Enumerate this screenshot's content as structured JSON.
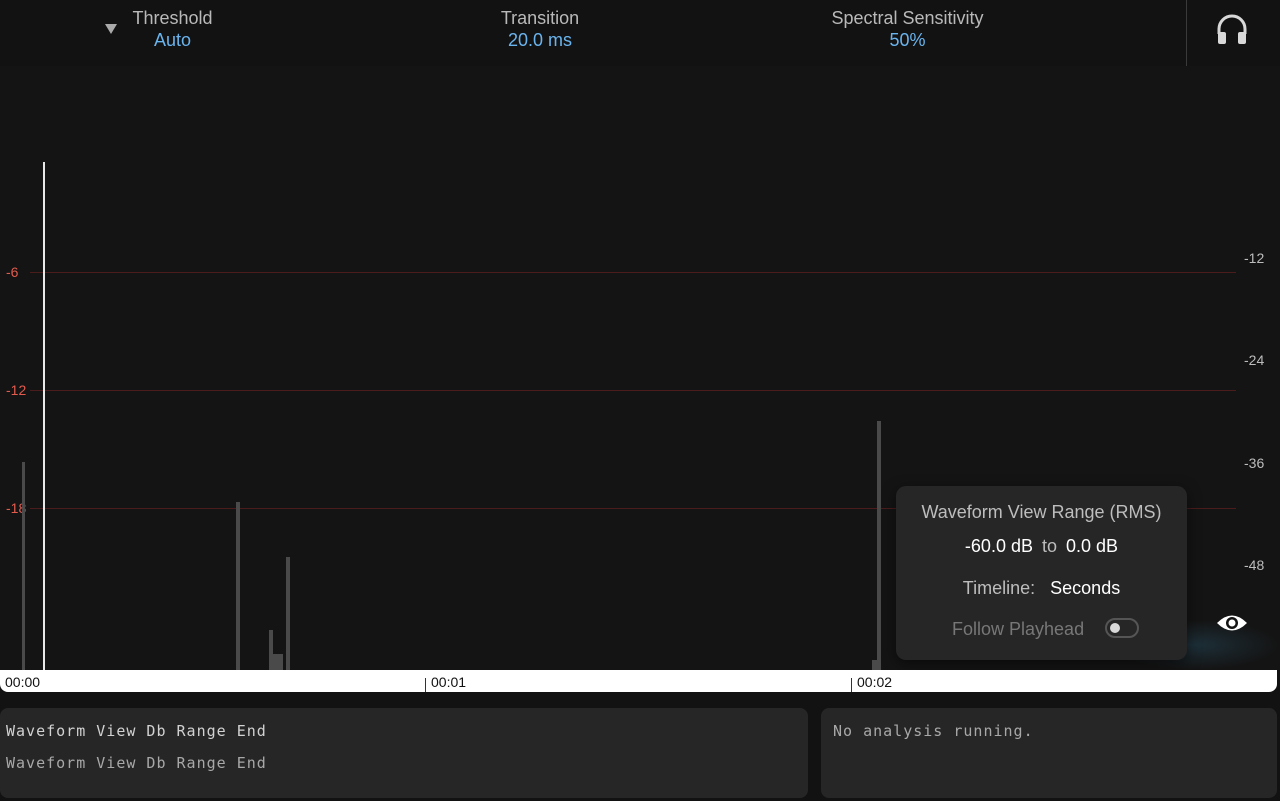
{
  "header": {
    "threshold": {
      "label": "Threshold",
      "value": "Auto"
    },
    "transition": {
      "label": "Transition",
      "value": "20.0 ms"
    },
    "sensitivity": {
      "label": "Spectral Sensitivity",
      "value": "50%"
    }
  },
  "waveform": {
    "db_left": [
      "-6",
      "-12",
      "-18"
    ],
    "db_right": [
      "-12",
      "-24",
      "-36",
      "-48"
    ]
  },
  "popover": {
    "title": "Waveform View Range (RMS)",
    "range_start": "-60.0 dB",
    "range_to": "to",
    "range_end": "0.0 dB",
    "timeline_label": "Timeline:",
    "timeline_value": "Seconds",
    "follow_label": "Follow Playhead",
    "follow_on": false
  },
  "timeline": {
    "labels": [
      "00:00",
      "00:01",
      "00:02"
    ]
  },
  "status": {
    "left_line1": "Waveform View Db Range End",
    "left_line2": "Waveform View Db Range End",
    "right": "No analysis running."
  },
  "colors": {
    "accent": "#6ab4ee",
    "db_red": "#e25c4e",
    "background": "#121212",
    "panel": "#262626"
  },
  "icons": {
    "dropdown": "triangle-down-icon",
    "monitor": "headphones-icon",
    "view": "eye-icon"
  }
}
